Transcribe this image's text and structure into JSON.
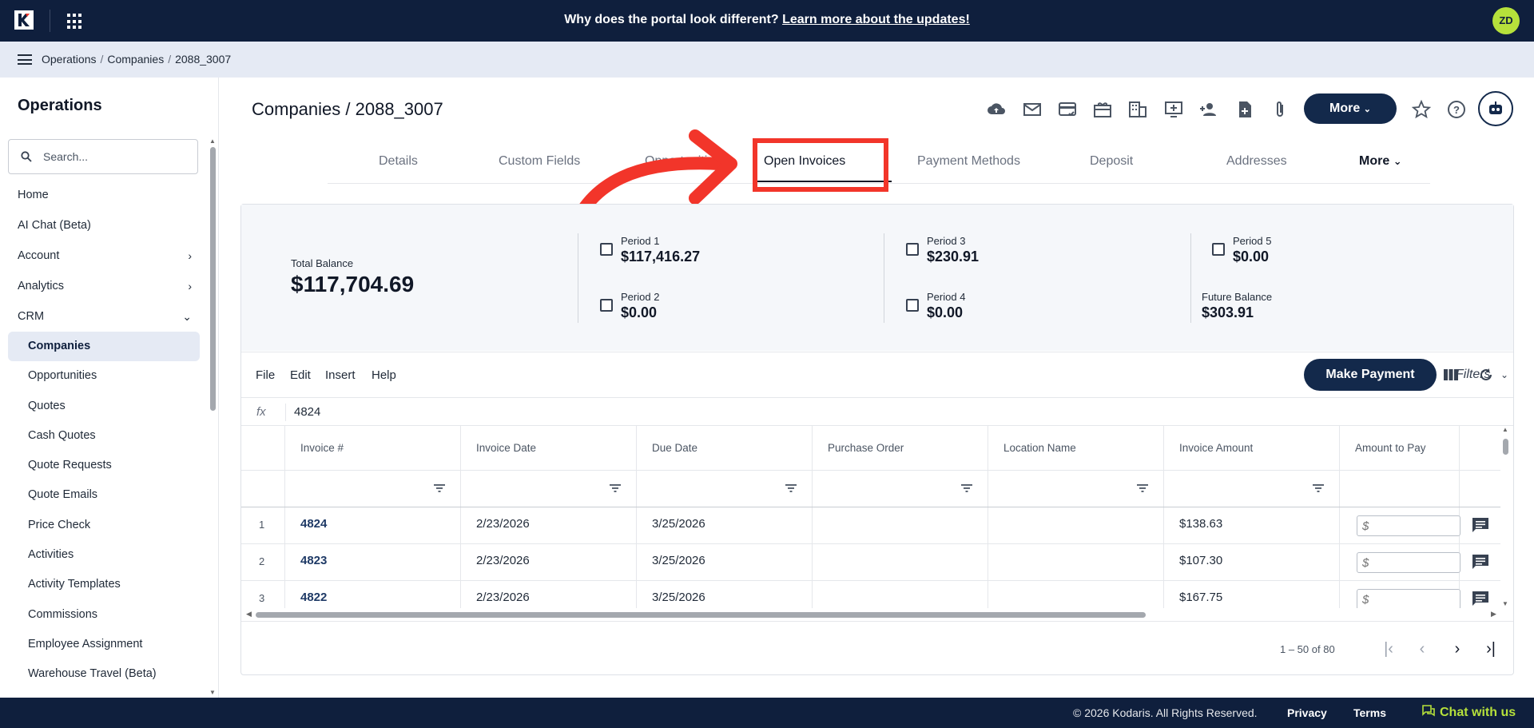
{
  "banner": {
    "question": "Why does the portal look different?",
    "link": "Learn more about the updates!"
  },
  "user": {
    "initials": "ZD"
  },
  "breadcrumb": [
    "Operations",
    "Companies",
    "2088_3007"
  ],
  "sidebar": {
    "title": "Operations",
    "search_placeholder": "Search...",
    "items": [
      {
        "label": "Home"
      },
      {
        "label": "AI Chat (Beta)"
      },
      {
        "label": "Account"
      },
      {
        "label": "Analytics"
      },
      {
        "label": "CRM"
      }
    ],
    "crm_items": [
      "Companies",
      "Opportunities",
      "Quotes",
      "Cash Quotes",
      "Quote Requests",
      "Quote Emails",
      "Price Check",
      "Activities",
      "Activity Templates",
      "Commissions",
      "Employee Assignment",
      "Warehouse Travel (Beta)"
    ]
  },
  "page": {
    "title": "Companies / 2088_3007",
    "more_label": "More"
  },
  "tabs": [
    {
      "label": "Details"
    },
    {
      "label": "Custom Fields"
    },
    {
      "label": "Opportunities"
    },
    {
      "label": "Open Invoices"
    },
    {
      "label": "Payment Methods"
    },
    {
      "label": "Deposit"
    },
    {
      "label": "Addresses"
    },
    {
      "label": "More"
    }
  ],
  "balance": {
    "total_label": "Total Balance",
    "total_value": "$117,704.69",
    "periods": [
      {
        "label": "Period 1",
        "value": "$117,416.27"
      },
      {
        "label": "Period 2",
        "value": "$0.00"
      },
      {
        "label": "Period 3",
        "value": "$230.91"
      },
      {
        "label": "Period 4",
        "value": "$0.00"
      },
      {
        "label": "Period 5",
        "value": "$0.00"
      }
    ],
    "future_label": "Future Balance",
    "future_value": "$303.91"
  },
  "toolbar": {
    "menus": [
      "File",
      "Edit",
      "Insert",
      "Help"
    ],
    "filters_label": "Filters",
    "make_payment": "Make Payment"
  },
  "formula": {
    "label": "fx",
    "value": "4824"
  },
  "table": {
    "columns": [
      "Invoice #",
      "Invoice Date",
      "Due Date",
      "Purchase Order",
      "Location Name",
      "Invoice Amount",
      "Amount to Pay"
    ],
    "rows": [
      {
        "num": "1",
        "invoice": "4824",
        "invoice_date": "2/23/2026",
        "due_date": "3/25/2026",
        "po": "",
        "location": "",
        "amount": "$138.63",
        "pay_placeholder": "$"
      },
      {
        "num": "2",
        "invoice": "4823",
        "invoice_date": "2/23/2026",
        "due_date": "3/25/2026",
        "po": "",
        "location": "",
        "amount": "$107.30",
        "pay_placeholder": "$"
      },
      {
        "num": "3",
        "invoice": "4822",
        "invoice_date": "2/23/2026",
        "due_date": "3/25/2026",
        "po": "",
        "location": "",
        "amount": "$167.75",
        "pay_placeholder": "$"
      }
    ]
  },
  "pager": {
    "range": "1 – 50 of 80"
  },
  "footer": {
    "copyright": "© 2026 Kodaris. All Rights Reserved.",
    "privacy": "Privacy",
    "terms": "Terms",
    "chat": "Chat with us"
  },
  "colors": {
    "navy": "#0f1f3d",
    "button": "#13294b",
    "accent_lime": "#b6e13b",
    "highlight_red": "#f2352a"
  }
}
